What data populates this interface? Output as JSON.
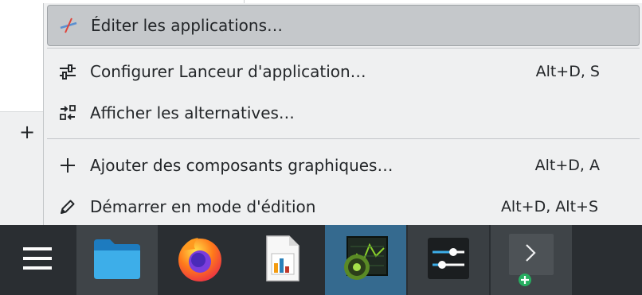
{
  "context_menu": {
    "items": [
      {
        "label": "Éditer les applications…",
        "shortcut": "",
        "icon": "edit-applications-icon"
      },
      {
        "label": "Configurer Lanceur d'application…",
        "shortcut": "Alt+D, S",
        "icon": "configure-icon"
      },
      {
        "label": "Afficher les alternatives…",
        "shortcut": "",
        "icon": "alternatives-icon"
      },
      {
        "label": "Ajouter des composants graphiques…",
        "shortcut": "Alt+D, A",
        "icon": "add-icon"
      },
      {
        "label": "Démarrer en mode d'édition",
        "shortcut": "Alt+D, Alt+S",
        "icon": "pencil-icon"
      }
    ]
  },
  "desktop": {
    "side_plus": "+"
  },
  "taskbar": {
    "items": [
      {
        "name": "application-launcher",
        "icon": "hamburger-menu-icon"
      },
      {
        "name": "dolphin-file-manager",
        "icon": "folder-icon"
      },
      {
        "name": "firefox",
        "icon": "firefox-icon"
      },
      {
        "name": "libreoffice-calc",
        "icon": "spreadsheet-icon"
      },
      {
        "name": "system-monitor",
        "icon": "monitor-icon"
      },
      {
        "name": "system-settings",
        "icon": "settings-sliders-icon"
      },
      {
        "name": "terminal",
        "icon": "terminal-icon"
      }
    ]
  },
  "colors": {
    "menu_bg": "#eff0f1",
    "highlight": "#c5c8cb",
    "taskbar_bg": "#2a2e32",
    "focused_task": "#356a8f",
    "text": "#232629"
  }
}
